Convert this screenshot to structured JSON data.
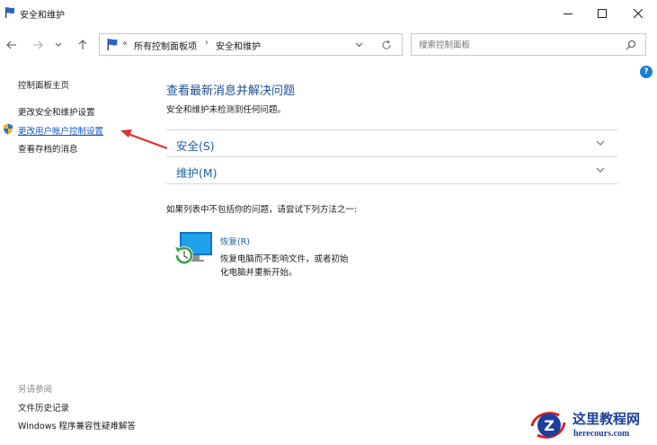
{
  "window": {
    "title": "安全和维护"
  },
  "address_bar": {
    "separator": "«",
    "crumbs": [
      "所有控制面板项",
      "安全和维护"
    ]
  },
  "search": {
    "placeholder": "搜索控制面板"
  },
  "sidebar": {
    "home": "控制面板主页",
    "items": [
      "更改安全和维护设置",
      "更改用户帐户控制设置",
      "查看存档的消息"
    ],
    "see_also_title": "另请参阅",
    "see_also": [
      "文件历史记录",
      "Windows 程序兼容性疑难解答"
    ]
  },
  "main": {
    "title": "查看最新消息并解决问题",
    "status": "安全和维护未检测到任何问题。",
    "sections": [
      "安全(S)",
      "维护(M)"
    ],
    "suggest": "如果列表中不包括你的问题，请尝试下列方法之一:",
    "recovery": {
      "link": "恢复(R)",
      "desc_line1": "恢复电脑而不影响文件，或者初始",
      "desc_line2": "化电脑并重新开始。"
    }
  },
  "help": {
    "glyph": "?"
  },
  "watermark": {
    "cn": "这里教程网",
    "en": "herecours.com",
    "logo_letter": "Z"
  },
  "colors": {
    "link_blue": "#1d5fa8",
    "highlight_link": "#0b57c5",
    "arrow_red": "#e03030",
    "watermark_blue": "#1b3f9c"
  }
}
